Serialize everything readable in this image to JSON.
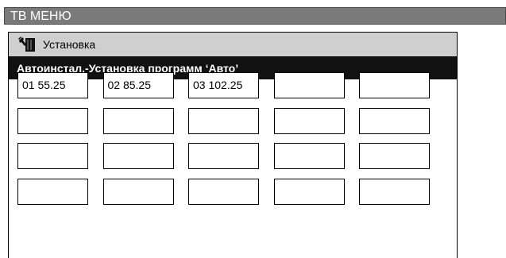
{
  "menu": {
    "title": "ТВ МЕНЮ"
  },
  "panel": {
    "header_label": "Установка",
    "header_icon": "wrench-tool-icon",
    "subtitle": "Автоинстал.-Установка программ ‘Авто’"
  },
  "channels": [
    "01 55.25",
    "02 85.25",
    "03 102.25",
    "",
    "",
    "",
    "",
    "",
    "",
    "",
    "",
    "",
    "",
    "",
    "",
    "",
    "",
    "",
    "",
    ""
  ]
}
